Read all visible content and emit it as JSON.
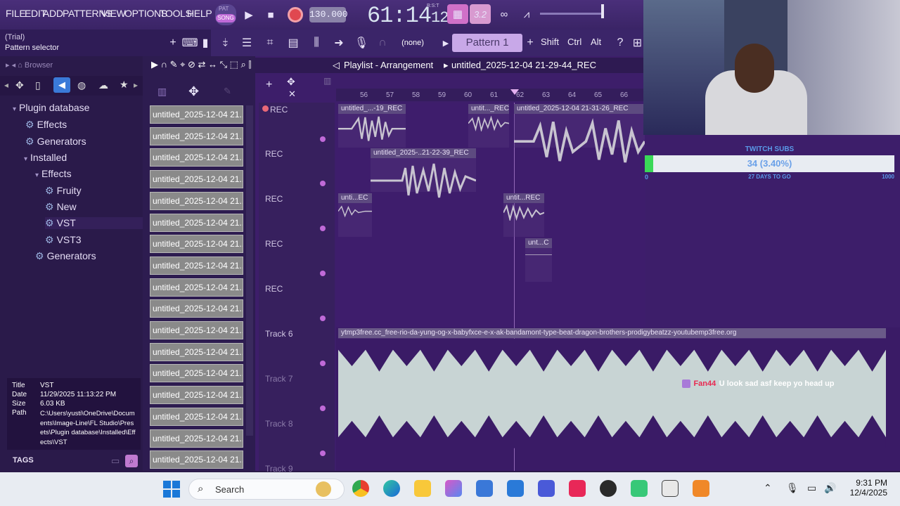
{
  "menu": [
    "FILE",
    "EDIT",
    "ADD",
    "PATTERNS",
    "VIEW",
    "OPTIONS",
    "TOOLS",
    "HELP"
  ],
  "transport": {
    "mode_pat": "PAT",
    "mode_song": "SONG",
    "tempo": "130.000",
    "time": "61:14",
    "time_small": "12",
    "time_unit": "B:S:T",
    "beat_value": "3.2"
  },
  "hint": {
    "line1": "(Trial)",
    "line2": "Pattern selector"
  },
  "toolbar2": {
    "none_label": "(none)",
    "pattern_label": "Pattern 1",
    "shift": "Shift",
    "ctrl": "Ctrl",
    "alt": "Alt"
  },
  "browser": {
    "title": "Browser",
    "tree": [
      {
        "label": "Plugin database",
        "indent": 0,
        "kind": "folder"
      },
      {
        "label": "Effects",
        "indent": 1,
        "kind": "gear"
      },
      {
        "label": "Generators",
        "indent": 1,
        "kind": "gear"
      },
      {
        "label": "Installed",
        "indent": 1,
        "kind": "folder"
      },
      {
        "label": "Effects",
        "indent": 2,
        "kind": "folder"
      },
      {
        "label": "Fruity",
        "indent": 3,
        "kind": "gear"
      },
      {
        "label": "New",
        "indent": 3,
        "kind": "gear"
      },
      {
        "label": "VST",
        "indent": 3,
        "kind": "gear"
      },
      {
        "label": "VST3",
        "indent": 3,
        "kind": "gear"
      },
      {
        "label": "Generators",
        "indent": 2,
        "kind": "gear"
      }
    ],
    "info": {
      "title_label": "Title",
      "title_value": "VST",
      "date_label": "Date",
      "date_value": "11/29/2025 11:13:22 PM",
      "size_label": "Size",
      "size_value": "6.03 KB",
      "path_label": "Path",
      "path_value": "C:\\Users\\yusti\\OneDrive\\Documents\\Image-Line\\FL Studio\\Presets\\Plugin database\\Installed\\Effects\\VST"
    },
    "tags_label": "TAGS"
  },
  "patterns": [
    "untitled_2025-12-04 21...",
    "untitled_2025-12-04 21...",
    "untitled_2025-12-04 21...",
    "untitled_2025-12-04 21...",
    "untitled_2025-12-04 21...",
    "untitled_2025-12-04 21...",
    "untitled_2025-12-04 21...",
    "untitled_2025-12-04 21...",
    "untitled_2025-12-04 21...",
    "untitled_2025-12-04 21...",
    "untitled_2025-12-04 21...",
    "untitled_2025-12-04 21...",
    "untitled_2025-12-04 21...",
    "untitled_2025-12-04 21...",
    "untitled_2025-12-04 21...",
    "untitled_2025-12-04 21...",
    "untitled_2025-12-04 21..."
  ],
  "playlist": {
    "title": "Playlist - Arrangement",
    "project": "untitled_2025-12-04 21-29-44_REC",
    "ruler": [
      "56",
      "57",
      "58",
      "59",
      "60",
      "61",
      "62",
      "63",
      "64",
      "65",
      "66"
    ],
    "tracks": [
      "REC",
      "REC",
      "REC",
      "REC",
      "REC",
      "Track 6",
      "Track 7",
      "Track 8",
      "Track 9"
    ],
    "clips": {
      "c1": "untitled_...-19_REC",
      "c2": "untit..._REC",
      "c3": "untitled_2025-12-04 21-31-26_REC",
      "c4": "untitled_2025-..21-22-39_REC",
      "c5": "unti...EC",
      "c6": "untit...REC",
      "c7": "unt...C",
      "c8": "ytmp3free.cc_free-rio-da-yung-og-x-babyfxce-e-x-ak-bandamont-type-beat-dragon-brothers-prodigybeatzz-youtubemp3free.org"
    }
  },
  "overlay": {
    "subs_title": "TWITCH SUBS",
    "subs_value": "34 (3.40%)",
    "subs_fraction": 0.034,
    "subs_min": "0",
    "subs_days": "27 DAYS TO GO",
    "subs_max": "1000",
    "chat_user": "Fan44",
    "chat_message": "U look sad asf keep yo head up"
  },
  "taskbar": {
    "search": "Search",
    "time": "9:31 PM",
    "date": "12/4/2025"
  }
}
